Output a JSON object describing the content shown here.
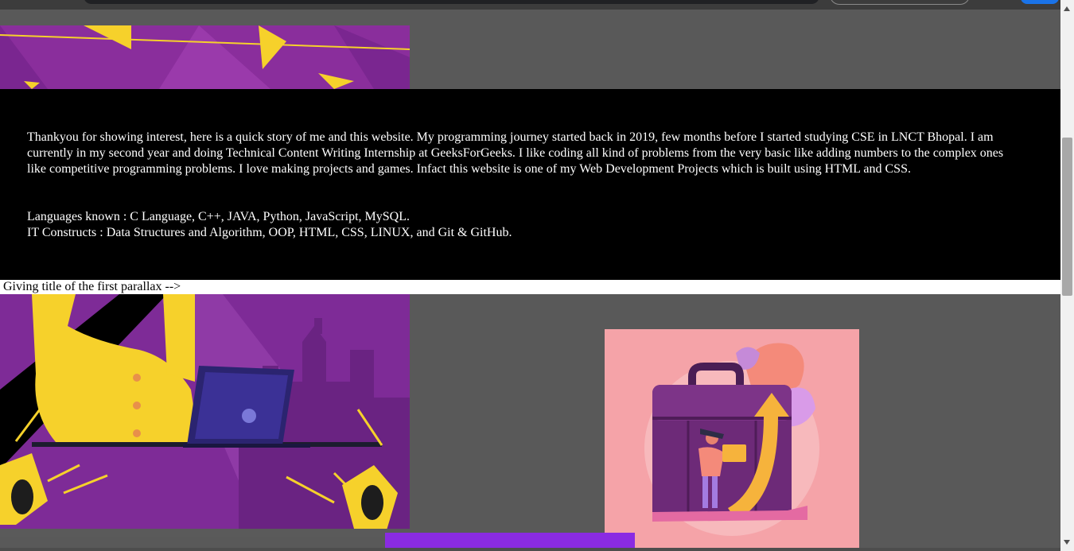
{
  "about": {
    "story": "Thankyou for showing interest, here is a quick story of me and this website. My programming journey started back in 2019, few months before I started studying CSE in LNCT Bhopal. I am currently in my second year and doing Technical Content Writing Internship at GeeksForGeeks. I like coding all kind of problems from the very basic like adding numbers to the complex ones like competitive programming problems. I love making projects and games. Infact this website is one of my Web Development Projects which is built using HTML and CSS.",
    "languages": "Languages known : C Language, C++, JAVA, Python, JavaScript, MySQL.",
    "constructs": "IT Constructs : Data Structures and Algorithm, OOP, HTML, CSS, LINUX, and Git & GitHub."
  },
  "comment_strip": {
    "text": "Giving title of the first parallax -->"
  },
  "colors": {
    "page_background": "#595959",
    "band_background": "#000000",
    "accent_purple": "#8a2be2",
    "illustration_purple": "#7b2d96",
    "illustration_yellow": "#f6d12b",
    "illustration_pink": "#f5a3a8"
  },
  "scrollbar": {
    "position": 0.25
  }
}
